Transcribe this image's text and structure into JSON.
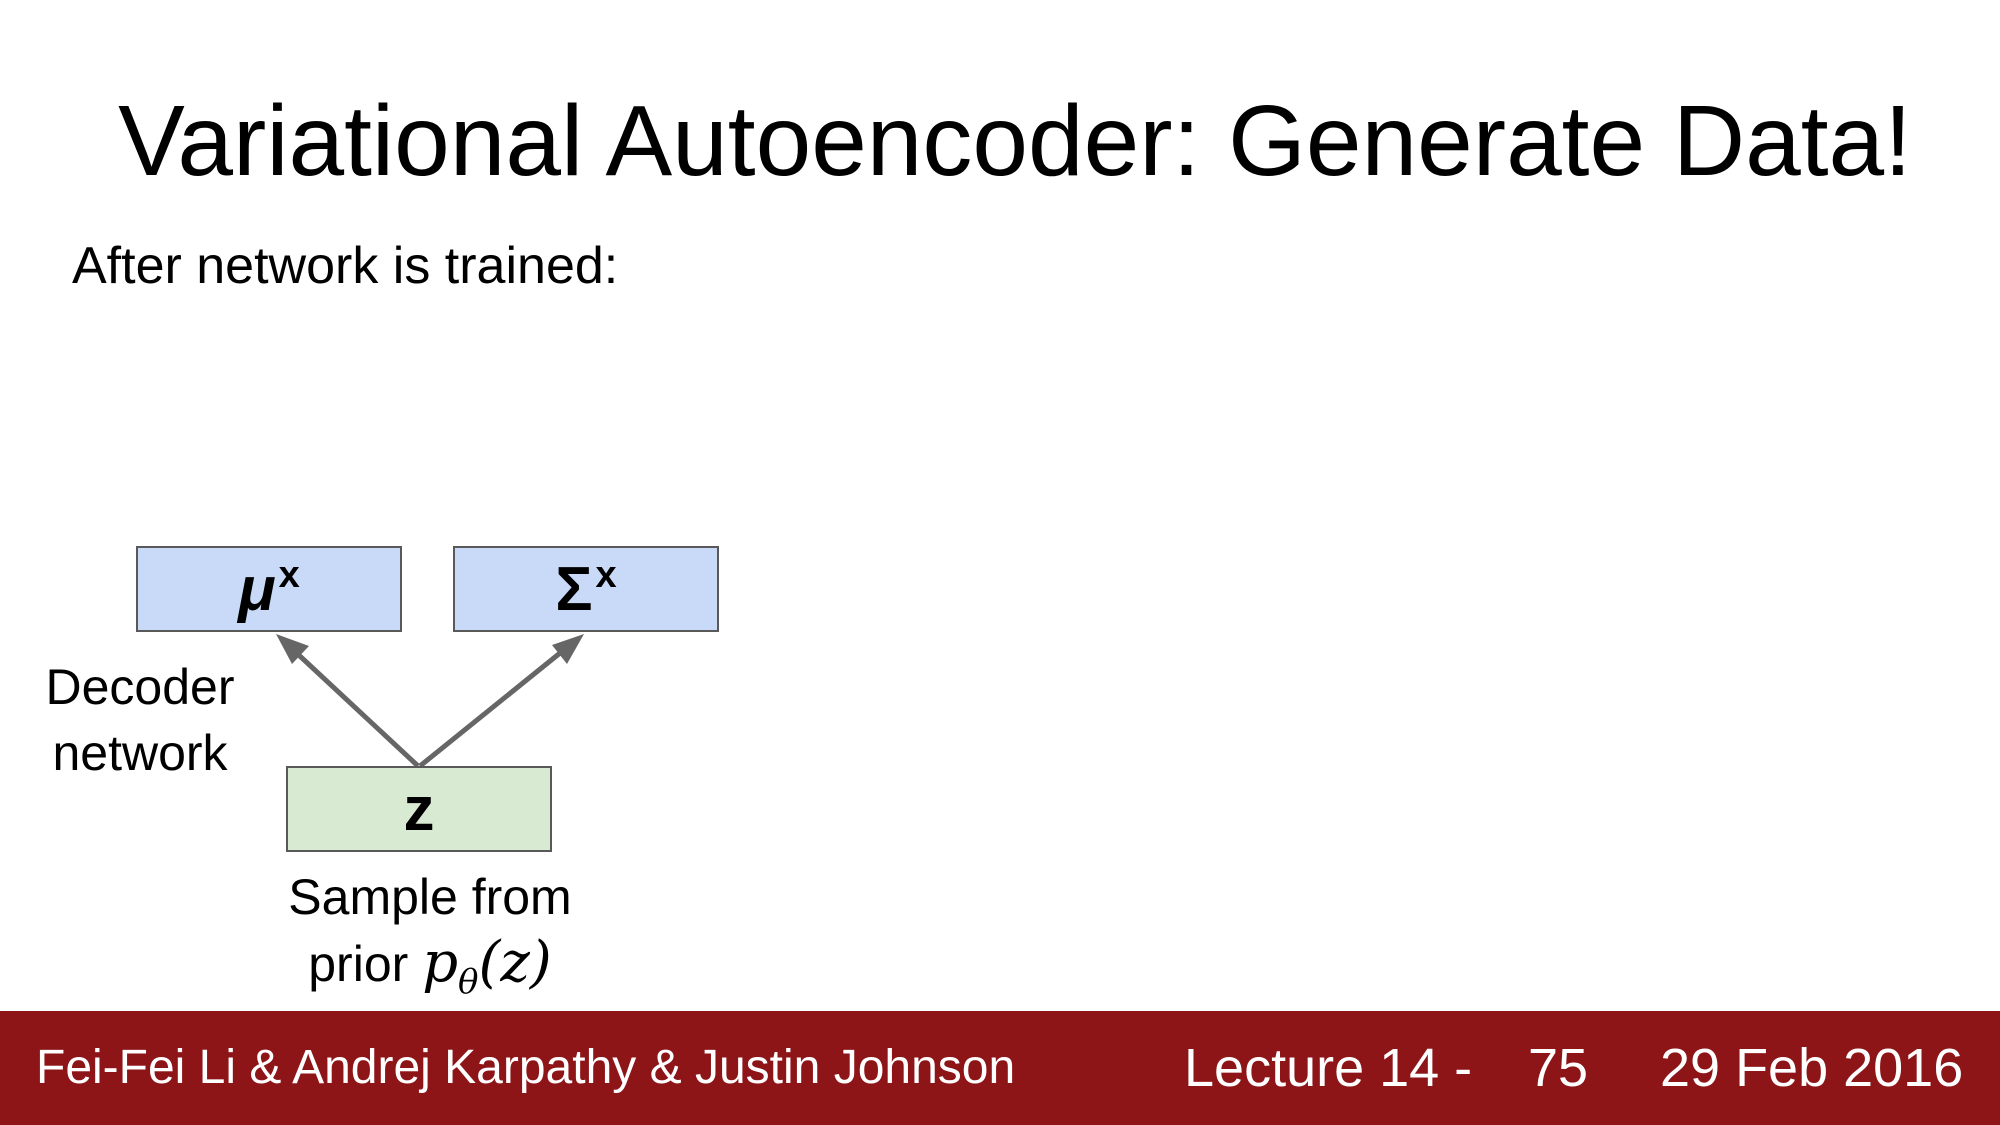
{
  "slide": {
    "title": "Variational Autoencoder: Generate Data!",
    "subtitle": "After network is trained:"
  },
  "diagram": {
    "mu_box": {
      "symbol": "μ",
      "superscript": "x"
    },
    "sigma_box": {
      "symbol": "Σ",
      "superscript": "x"
    },
    "z_box": {
      "symbol": "z"
    },
    "decoder_label": [
      "Decoder",
      "network"
    ],
    "sample_label": {
      "line1": "Sample from",
      "line2_text": "prior",
      "math_base": "p",
      "math_sub": "θ",
      "math_arg": "(z)"
    },
    "colors": {
      "blue_box": "#c9daf8",
      "green_box": "#d9ead3",
      "arrow": "#666666",
      "border": "#595959"
    }
  },
  "footer": {
    "authors": "Fei-Fei Li & Andrej Karpathy & Justin Johnson",
    "lecture": "Lecture 14 -",
    "page": "75",
    "date": "29 Feb 2016",
    "color": "#8d1518"
  }
}
